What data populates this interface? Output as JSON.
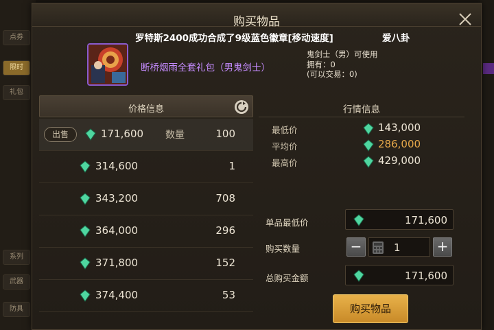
{
  "background": {
    "tabs": [
      "点券",
      "限时",
      "礼包",
      "武器",
      "防具",
      "系列"
    ]
  },
  "window": {
    "title": "购买物品",
    "announcement": "罗特斯2400成功合成了9级蓝色徽章[移动速度]",
    "announcement_user": "爱八卦"
  },
  "item": {
    "name": "断桥烟雨全套礼包（男鬼剑士）",
    "info_lines": [
      "鬼剑士（男）可使用",
      "拥有：0",
      "(可以交易：0)"
    ],
    "name_color": "#c58cff"
  },
  "price_panel": {
    "header": "价格信息",
    "sell_label": "出售",
    "quantity_label": "数量",
    "listings": [
      {
        "price": "171,600",
        "qty": "100"
      },
      {
        "price": "314,600",
        "qty": "1"
      },
      {
        "price": "343,200",
        "qty": "708"
      },
      {
        "price": "364,000",
        "qty": "296"
      },
      {
        "price": "371,800",
        "qty": "152"
      },
      {
        "price": "374,400",
        "qty": "53"
      }
    ]
  },
  "market_panel": {
    "header": "行情信息",
    "stats": [
      {
        "label": "最低价",
        "value": "143,000"
      },
      {
        "label": "平均价",
        "value": "286,000"
      },
      {
        "label": "最高价",
        "value": "429,000"
      }
    ]
  },
  "purchase": {
    "unit_min_label": "单品最低价",
    "unit_min_value": "171,600",
    "qty_label": "购买数量",
    "qty_value": "1",
    "total_label": "总购买金额",
    "total_value": "171,600",
    "buy_button": "购买物品"
  },
  "colors": {
    "gem": "#4fd6a0",
    "highlight": "#e8a94a",
    "buy_button": "#e0a23c"
  }
}
